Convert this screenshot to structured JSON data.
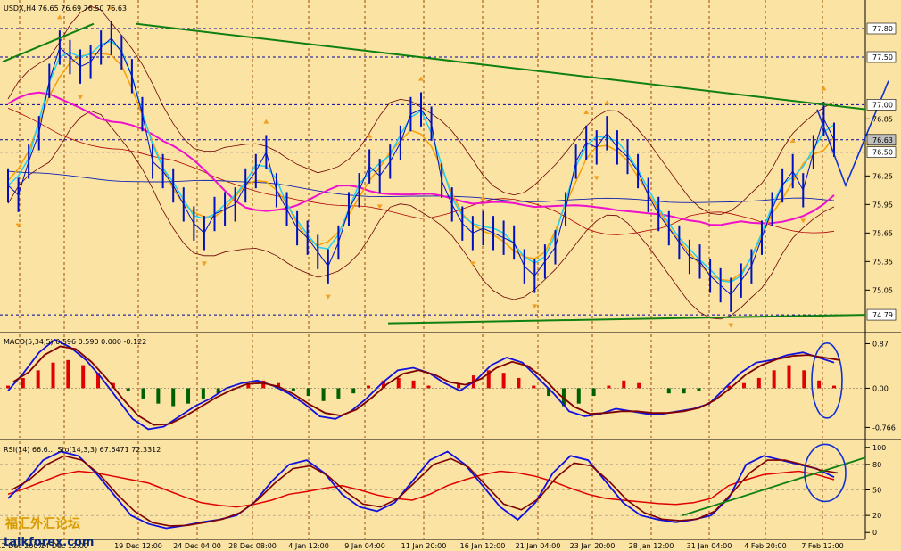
{
  "chart_data": {
    "type": "line",
    "symbol": "USDX,H4",
    "ohlc_text": "76.65 76.69 76.50 76.63",
    "price_axis": {
      "ylim": [
        74.65,
        77.95
      ],
      "ticks": [
        "77.80",
        "77.50",
        "77.00",
        "76.85",
        "76.63",
        "76.50",
        "76.25",
        "75.95",
        "75.65",
        "75.35",
        "75.05",
        "74.79"
      ],
      "boxed": [
        "77.80",
        "77.50",
        "77.00",
        "76.63",
        "76.50",
        "74.79"
      ]
    },
    "macd_header": "MACD(5,34,5) 0.596 0.590 0.000 -0.122",
    "macd_axis": {
      "ylim": [
        -0.95,
        1.0
      ],
      "ticks": [
        "0.87",
        "0.00",
        "-0.766"
      ]
    },
    "rsi_header": "RSI(14) 66.6…  Sto(14,3,3) 67.6471 72.3312",
    "rsi_axis": {
      "ylim": [
        -5,
        105
      ],
      "ticks": [
        "100",
        "80",
        "50",
        "20",
        "0"
      ]
    },
    "x_labels": [
      "12 Dec 2007",
      "14 Dec 12:00",
      "19 Dec 12:00",
      "24 Dec 04:00",
      "28 Dec 08:00",
      "4 Jan 12:00",
      "9 Jan 04:00",
      "11 Jan 20:00",
      "16 Jan 12:00",
      "21 Jan 04:00",
      "23 Jan 20:00",
      "28 Jan 12:00",
      "31 Jan 04:00",
      "4 Feb 20:00",
      "7 Feb 12:00"
    ],
    "close": [
      76.15,
      76.05,
      76.4,
      76.7,
      77.25,
      77.6,
      77.5,
      77.4,
      77.45,
      77.6,
      77.7,
      77.55,
      77.3,
      76.9,
      76.4,
      76.3,
      76.15,
      75.95,
      75.75,
      75.65,
      75.85,
      75.9,
      75.95,
      76.15,
      76.3,
      76.5,
      76.1,
      75.9,
      75.7,
      75.6,
      75.45,
      75.3,
      75.55,
      75.9,
      76.1,
      76.35,
      76.25,
      76.4,
      76.6,
      76.9,
      76.95,
      76.8,
      76.2,
      75.95,
      75.75,
      75.65,
      75.7,
      75.65,
      75.6,
      75.55,
      75.3,
      75.2,
      75.35,
      75.5,
      75.9,
      76.4,
      76.6,
      76.55,
      76.7,
      76.55,
      76.45,
      76.3,
      76.05,
      75.85,
      75.7,
      75.55,
      75.4,
      75.35,
      75.2,
      75.1,
      75.0,
      75.15,
      75.3,
      75.6,
      75.9,
      76.15,
      76.3,
      76.1,
      76.5,
      76.85,
      76.63
    ],
    "macd_hist": [
      0.05,
      0.2,
      0.35,
      0.5,
      0.55,
      0.45,
      0.3,
      0.1,
      -0.05,
      -0.2,
      -0.3,
      -0.35,
      -0.3,
      -0.2,
      -0.1,
      0.0,
      0.1,
      0.15,
      0.1,
      -0.05,
      -0.15,
      -0.25,
      -0.2,
      -0.1,
      0.05,
      0.15,
      0.2,
      0.15,
      0.05,
      0.0,
      0.1,
      0.25,
      0.35,
      0.3,
      0.2,
      0.05,
      -0.15,
      -0.35,
      -0.3,
      -0.15,
      0.05,
      0.15,
      0.1,
      0.0,
      -0.1,
      -0.1,
      -0.05,
      0.0,
      0.05,
      0.1,
      0.2,
      0.35,
      0.45,
      0.35,
      0.15,
      0.05
    ],
    "macd_line": [
      -0.05,
      0.3,
      0.7,
      0.95,
      0.8,
      0.55,
      0.2,
      -0.2,
      -0.6,
      -0.8,
      -0.75,
      -0.55,
      -0.35,
      -0.2,
      0.0,
      0.1,
      0.15,
      0.05,
      -0.1,
      -0.3,
      -0.55,
      -0.6,
      -0.45,
      -0.2,
      0.1,
      0.35,
      0.4,
      0.3,
      0.1,
      -0.05,
      0.15,
      0.45,
      0.6,
      0.5,
      0.2,
      -0.1,
      -0.45,
      -0.55,
      -0.5,
      -0.4,
      -0.45,
      -0.5,
      -0.5,
      -0.45,
      -0.4,
      -0.3,
      0.0,
      0.3,
      0.5,
      0.55,
      0.65,
      0.7,
      0.6,
      0.5
    ],
    "rsi": [
      45,
      52,
      60,
      68,
      72,
      70,
      66,
      62,
      58,
      50,
      42,
      35,
      32,
      30,
      33,
      38,
      45,
      48,
      52,
      55,
      50,
      44,
      40,
      38,
      45,
      55,
      62,
      68,
      72,
      70,
      66,
      60,
      52,
      45,
      40,
      38,
      36,
      34,
      33,
      35,
      40,
      55,
      62,
      68,
      70,
      72,
      68,
      62
    ],
    "stoch": [
      40,
      60,
      85,
      95,
      90,
      70,
      45,
      20,
      10,
      5,
      8,
      12,
      15,
      20,
      35,
      60,
      80,
      85,
      70,
      45,
      30,
      25,
      35,
      60,
      85,
      95,
      80,
      55,
      30,
      15,
      35,
      70,
      90,
      85,
      60,
      35,
      20,
      15,
      12,
      15,
      20,
      40,
      80,
      90,
      85,
      80,
      75,
      65
    ]
  }
}
